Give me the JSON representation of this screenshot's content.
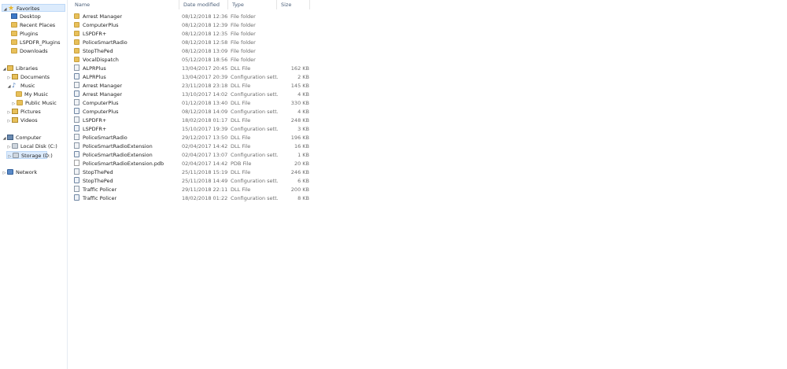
{
  "nav": {
    "favorites": "Favorites",
    "favorites_items": [
      {
        "label": "Desktop",
        "icon": "desktop-icon"
      },
      {
        "label": "Recent Places",
        "icon": "folder-icon"
      },
      {
        "label": "Plugins",
        "icon": "folder-icon"
      },
      {
        "label": "LSPDFR_Plugins",
        "icon": "folder-icon"
      },
      {
        "label": "Downloads",
        "icon": "folder-icon"
      }
    ],
    "libraries": "Libraries",
    "documents": "Documents",
    "music": "Music",
    "my_music": "My Music",
    "public_music": "Public Music",
    "pictures": "Pictures",
    "videos": "Videos",
    "computer": "Computer",
    "local_disk": "Local Disk (C:)",
    "storage": "Storage (D:)",
    "network": "Network"
  },
  "columns": {
    "name": "Name",
    "date": "Date modified",
    "type": "Type",
    "size": "Size"
  },
  "files": [
    {
      "name": "Arrest Manager",
      "date": "08/12/2018 12:36",
      "type": "File folder",
      "size": "",
      "kind": "folder"
    },
    {
      "name": "ComputerPlus",
      "date": "08/12/2018 12:39",
      "type": "File folder",
      "size": "",
      "kind": "folder"
    },
    {
      "name": "LSPDFR+",
      "date": "08/12/2018 12:35",
      "type": "File folder",
      "size": "",
      "kind": "folder"
    },
    {
      "name": "PoliceSmartRadio",
      "date": "08/12/2018 12:58",
      "type": "File folder",
      "size": "",
      "kind": "folder"
    },
    {
      "name": "StopThePed",
      "date": "08/12/2018 13:09",
      "type": "File folder",
      "size": "",
      "kind": "folder"
    },
    {
      "name": "VocalDispatch",
      "date": "05/12/2018 18:56",
      "type": "File folder",
      "size": "",
      "kind": "folder"
    },
    {
      "name": "ALPRPlus",
      "date": "13/04/2017 20:45",
      "type": "DLL File",
      "size": "162 KB",
      "kind": "dll"
    },
    {
      "name": "ALPRPlus",
      "date": "13/04/2017 20:39",
      "type": "Configuration sett...",
      "size": "2 KB",
      "kind": "cfg"
    },
    {
      "name": "Arrest Manager",
      "date": "23/11/2018 23:18",
      "type": "DLL File",
      "size": "145 KB",
      "kind": "dll"
    },
    {
      "name": "Arrest Manager",
      "date": "13/10/2017 14:02",
      "type": "Configuration sett...",
      "size": "4 KB",
      "kind": "cfg"
    },
    {
      "name": "ComputerPlus",
      "date": "01/12/2018 13:40",
      "type": "DLL File",
      "size": "330 KB",
      "kind": "dll"
    },
    {
      "name": "ComputerPlus",
      "date": "08/12/2018 14:09",
      "type": "Configuration sett...",
      "size": "4 KB",
      "kind": "cfg"
    },
    {
      "name": "LSPDFR+",
      "date": "18/02/2018 01:17",
      "type": "DLL File",
      "size": "248 KB",
      "kind": "dll"
    },
    {
      "name": "LSPDFR+",
      "date": "15/10/2017 19:39",
      "type": "Configuration sett...",
      "size": "3 KB",
      "kind": "cfg"
    },
    {
      "name": "PoliceSmartRadio",
      "date": "29/12/2017 13:50",
      "type": "DLL File",
      "size": "196 KB",
      "kind": "dll"
    },
    {
      "name": "PoliceSmartRadioExtension",
      "date": "02/04/2017 14:42",
      "type": "DLL File",
      "size": "16 KB",
      "kind": "dll"
    },
    {
      "name": "PoliceSmartRadioExtension",
      "date": "02/04/2017 13:07",
      "type": "Configuration sett...",
      "size": "1 KB",
      "kind": "cfg"
    },
    {
      "name": "PoliceSmartRadioExtension.pdb",
      "date": "02/04/2017 14:42",
      "type": "PDB File",
      "size": "20 KB",
      "kind": "pdb"
    },
    {
      "name": "StopThePed",
      "date": "25/11/2018 15:19",
      "type": "DLL File",
      "size": "246 KB",
      "kind": "dll"
    },
    {
      "name": "StopThePed",
      "date": "25/11/2018 14:49",
      "type": "Configuration sett...",
      "size": "6 KB",
      "kind": "cfg"
    },
    {
      "name": "Traffic Policer",
      "date": "29/11/2018 22:11",
      "type": "DLL File",
      "size": "200 KB",
      "kind": "dll"
    },
    {
      "name": "Traffic Policer",
      "date": "18/02/2018 01:22",
      "type": "Configuration sett...",
      "size": "8 KB",
      "kind": "cfg"
    }
  ]
}
